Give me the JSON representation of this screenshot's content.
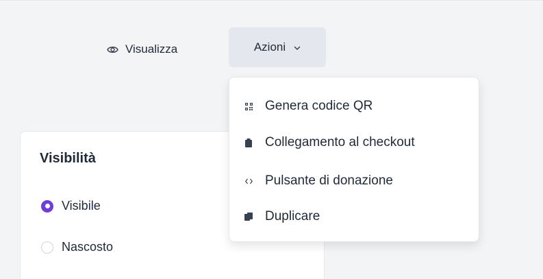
{
  "toolbar": {
    "view_label": "Visualizza",
    "actions_label": "Azioni"
  },
  "visibility_card": {
    "title": "Visibilità",
    "options": [
      {
        "label": "Visibile",
        "checked": true
      },
      {
        "label": "Nascosto",
        "checked": false
      }
    ]
  },
  "actions_menu": {
    "items": [
      {
        "label": "Genera codice QR",
        "icon": "qr-code-icon"
      },
      {
        "label": "Collegamento al checkout",
        "icon": "clipboard-icon"
      },
      {
        "label": "Pulsante di donazione",
        "icon": "code-icon"
      },
      {
        "label": "Duplicare",
        "icon": "copy-icon"
      }
    ]
  },
  "colors": {
    "accent": "#6d3fd6",
    "button_bg": "#e4e8ee",
    "page_bg": "#f3f4f6"
  }
}
